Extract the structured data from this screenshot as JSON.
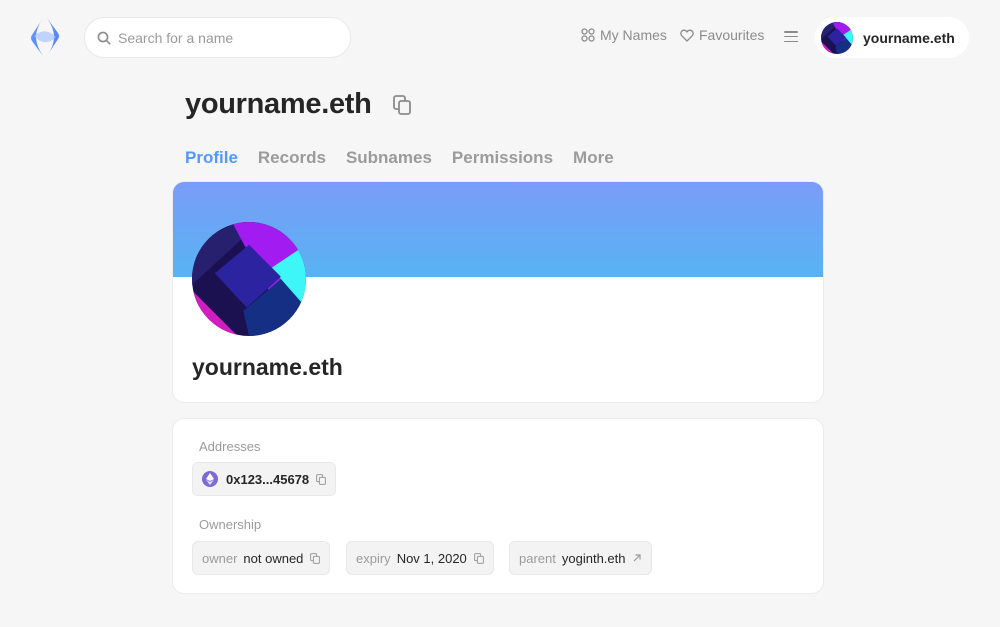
{
  "header": {
    "search_placeholder": "Search for a name",
    "my_names_label": "My Names",
    "favourites_label": "Favourites",
    "account_name": "yourname.eth"
  },
  "page": {
    "title": "yourname.eth",
    "tabs": [
      {
        "label": "Profile",
        "active": true
      },
      {
        "label": "Records",
        "active": false
      },
      {
        "label": "Subnames",
        "active": false
      },
      {
        "label": "Permissions",
        "active": false
      },
      {
        "label": "More",
        "active": false
      }
    ]
  },
  "profile": {
    "name": "yourname.eth"
  },
  "addresses": {
    "label": "Addresses",
    "eth_address": "0x123...45678"
  },
  "ownership": {
    "label": "Ownership",
    "owner_key": "owner",
    "owner_value": "not owned",
    "expiry_key": "expiry",
    "expiry_value": "Nov 1, 2020",
    "parent_key": "parent",
    "parent_value": "yoginth.eth"
  },
  "colors": {
    "accent": "#5298ff",
    "banner_top": "#7a9cf8",
    "banner_bottom": "#57b3f3",
    "background": "#f6f6f6"
  },
  "icons": [
    "ens-logo-icon",
    "search-icon",
    "grid-icon",
    "heart-icon",
    "menu-icon",
    "copy-icon",
    "eth-icon",
    "arrow-up-right-icon"
  ]
}
